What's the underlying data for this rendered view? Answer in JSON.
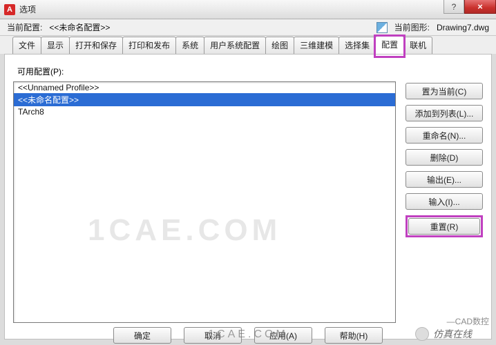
{
  "window": {
    "app_icon_letter": "A",
    "title": "选项",
    "close_glyph": "×",
    "help_glyph": "?"
  },
  "info": {
    "current_profile_label": "当前配置:",
    "current_profile_value": "<<未命名配置>>",
    "current_drawing_label": "当前图形:",
    "current_drawing_value": "Drawing7.dwg"
  },
  "tabs": [
    {
      "key": "file",
      "label": "文件"
    },
    {
      "key": "display",
      "label": "显示"
    },
    {
      "key": "opensave",
      "label": "打开和保存"
    },
    {
      "key": "plot",
      "label": "打印和发布"
    },
    {
      "key": "system",
      "label": "系统"
    },
    {
      "key": "usersys",
      "label": "用户系统配置"
    },
    {
      "key": "drafting",
      "label": "绘图"
    },
    {
      "key": "3dmodel",
      "label": "三维建模"
    },
    {
      "key": "selection",
      "label": "选择集"
    },
    {
      "key": "profiles",
      "label": "配置",
      "active": true,
      "highlighted": true
    },
    {
      "key": "online",
      "label": "联机"
    }
  ],
  "profiles": {
    "available_label": "可用配置(P):",
    "items": [
      {
        "text": "<<Unnamed Profile>>",
        "selected": false
      },
      {
        "text": "<<未命名配置>>",
        "selected": true
      },
      {
        "text": "TArch8",
        "selected": false
      }
    ]
  },
  "buttons": {
    "set_current": "置为当前(C)",
    "add_to_list": "添加到列表(L)...",
    "rename": "重命名(N)...",
    "delete": "删除(D)",
    "export": "输出(E)...",
    "import": "输入(I)...",
    "reset": "重置(R)"
  },
  "footer": {
    "ok": "确定",
    "cancel": "取消",
    "apply": "应用(A)",
    "help": "帮助(H)"
  },
  "watermarks": {
    "center": "1CAE.COM",
    "bottom": "1CAE.COM",
    "brand_note": "仿真在线",
    "small_note": "—CAD数控"
  }
}
